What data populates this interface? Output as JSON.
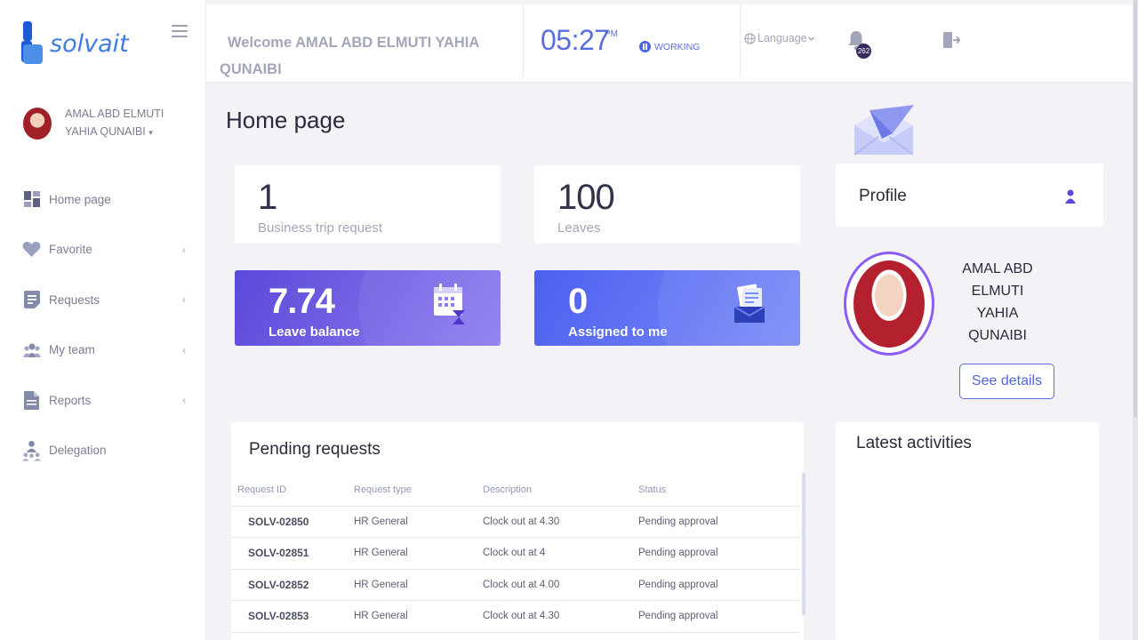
{
  "app": {
    "logo_text": "solvait"
  },
  "sidebar": {
    "user_name": "AMAL ABD ELMUTI YAHIA QUNAIBI",
    "user_caret": "▾",
    "items": [
      {
        "label": "Home page",
        "icon": "grid-icon",
        "has_children": false
      },
      {
        "label": "Favorite",
        "icon": "heart-icon",
        "has_children": true
      },
      {
        "label": "Requests",
        "icon": "document-list-icon",
        "has_children": true
      },
      {
        "label": "My team",
        "icon": "team-icon",
        "has_children": true
      },
      {
        "label": "Reports",
        "icon": "report-file-icon",
        "has_children": true
      },
      {
        "label": "Delegation",
        "icon": "delegation-icon",
        "has_children": false
      }
    ],
    "chevron": "‹"
  },
  "header": {
    "welcome_line1": "Welcome AMAL ABD ELMUTI YAHIA",
    "welcome_line2": "QUNAIBI",
    "time": "05:27",
    "ampm": "PM",
    "status": "WORKING",
    "language_label": "Language",
    "notification_count": "262"
  },
  "main": {
    "page_title": "Home page",
    "stats": [
      {
        "value": "1",
        "label": "Business trip request"
      },
      {
        "value": "100",
        "label": "Leaves"
      }
    ],
    "highlight_cards": [
      {
        "value": "7.74",
        "label": "Leave balance",
        "icon": "calendar-hourglass-icon",
        "color_from": "#5b49d9",
        "color_to": "#8e7ff0"
      },
      {
        "value": "0",
        "label": "Assigned to me",
        "icon": "inbox-documents-icon",
        "color_from": "#4c5ff0",
        "color_to": "#7e8ef7"
      }
    ],
    "pending": {
      "title": "Pending requests",
      "columns": [
        "Request ID",
        "Request type",
        "Description",
        "Status"
      ],
      "rows": [
        [
          "SOLV-02850",
          "HR General",
          "Clock out at 4.30",
          "Pending approval"
        ],
        [
          "SOLV-02851",
          "HR General",
          "Clock out at 4",
          "Pending approval"
        ],
        [
          "SOLV-02852",
          "HR General",
          "Clock out at 4.00",
          "Pending approval"
        ],
        [
          "SOLV-02853",
          "HR General",
          "Clock out at 4.30",
          "Pending approval"
        ]
      ]
    }
  },
  "profile": {
    "title": "Profile",
    "name_lines": [
      "AMAL ABD",
      "ELMUTI",
      "YAHIA",
      "QUNAIBI"
    ],
    "see_details": "See details"
  },
  "activities": {
    "title": "Latest activities"
  },
  "colors": {
    "accent": "#5a6de0",
    "purple": "#8b5cf6",
    "muted_text": "#a3a6b9"
  }
}
